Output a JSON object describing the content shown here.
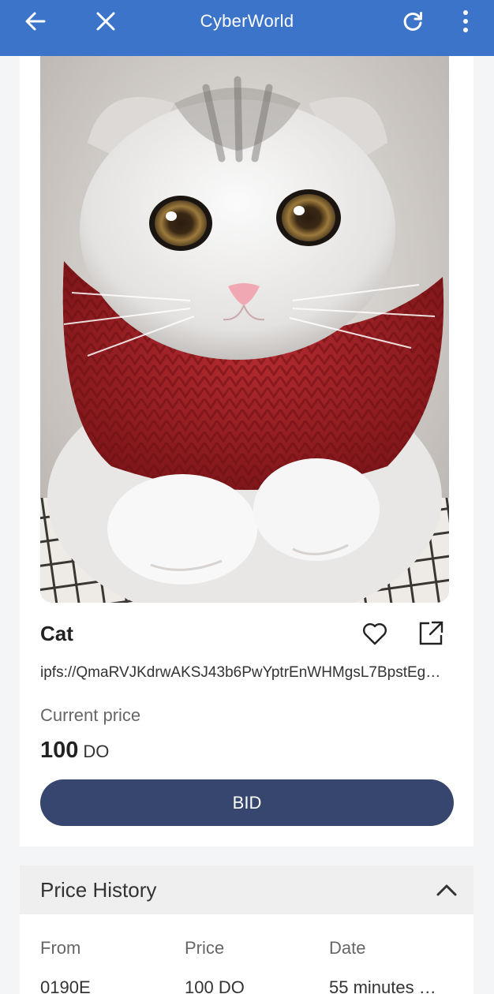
{
  "app": {
    "title": "CyberWorld"
  },
  "toolbar": {
    "back_icon": "arrow-left-icon",
    "close_icon": "close-icon",
    "refresh_icon": "refresh-icon",
    "menu_icon": "more-vert-icon"
  },
  "nft": {
    "image": "photo of a white and grey kitten wearing a red knitted scarf",
    "name": "Cat",
    "ipfs": "ipfs://QmaRVJKdrwAKSJ43b6PwYptrEnWHMgsL7BpstEg…",
    "price_label": "Current price",
    "price_value": "100",
    "price_unit": "DO",
    "bid_label": "BID",
    "favorite_icon": "heart-icon",
    "share_icon": "external-link-icon"
  },
  "history": {
    "title": "Price History",
    "toggle_icon": "chevron-up-icon",
    "columns": [
      "From",
      "Price",
      "Date"
    ],
    "rows": [
      {
        "from": "0190E",
        "price": "100 DO",
        "date": "55 minutes …"
      }
    ]
  },
  "colors": {
    "appbar": "#3c74c9",
    "bid_button": "#36466f",
    "scarf": "#a82328"
  }
}
